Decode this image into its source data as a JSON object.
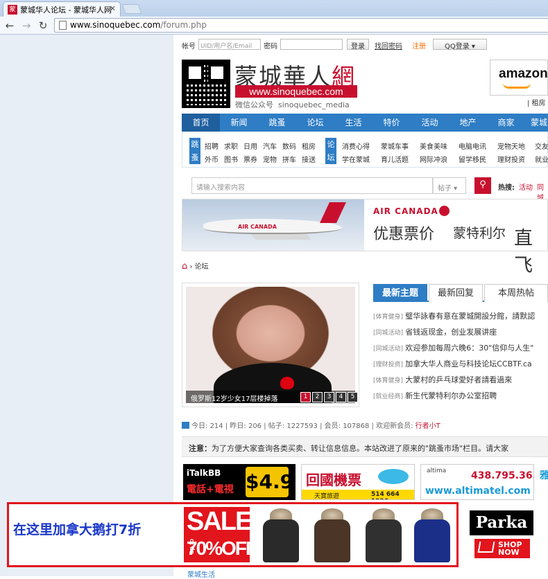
{
  "browser": {
    "tab_title": "蒙城华人论坛 - 蒙城华人网",
    "tab_favicon": "蒙",
    "url_domain": "www.sinoquebec.com",
    "url_path": "/forum.php"
  },
  "login": {
    "account_label": "帐号",
    "account_placeholder": "UID/用户名/Email",
    "password_label": "密码",
    "login_btn": "登录",
    "forgot": "找回密码",
    "register": "注册",
    "qq_login": "QQ登录"
  },
  "header": {
    "logo_text_a": "蒙城華人",
    "logo_text_b": "網",
    "logo_url": "www.sinoquebec.com",
    "wechat_label": "微信公众号",
    "wechat_id": "sinoquebec_media",
    "amazon_label": "amazon",
    "zufang": "| 租房"
  },
  "nav": {
    "items": [
      "首页",
      "新闻",
      "跳蚤",
      "论坛",
      "生活",
      "特价",
      "活动",
      "地产",
      "商家",
      "蒙城"
    ]
  },
  "subnav": {
    "tag1": "跳蚤",
    "tag2": "论坛",
    "row1_a": [
      "招聘",
      "求职",
      "日用",
      "汽车",
      "数码",
      "租房"
    ],
    "row2_a": [
      "外币",
      "图书",
      "票券",
      "宠物",
      "拼车",
      "接送"
    ],
    "row1_b": [
      "消费心得",
      "蒙城车事",
      "美食美味",
      "电脑电讯",
      "宠物天地",
      "交友"
    ],
    "row2_b": [
      "学在蒙城",
      "育儿活题",
      "网际冲浪",
      "留学移民",
      "理财投资",
      "就业"
    ]
  },
  "search": {
    "placeholder": "请输入搜索内容",
    "select": "帖子",
    "hot_label": "热搜:",
    "hot_words": [
      "活动",
      "同城"
    ]
  },
  "banner": {
    "brand": "AIR CANADA",
    "plane_label": "AIR CANADA",
    "t1": "优惠票价",
    "t2": "蒙特利尔",
    "t3": "直飞"
  },
  "breadcrumb": {
    "home": "⌂",
    "sep": "›",
    "current": "论坛"
  },
  "slider": {
    "caption": "俄罗斯12岁少女17层楼掉落",
    "pages": [
      "1",
      "2",
      "3",
      "4",
      "5"
    ]
  },
  "topics": {
    "tabs": [
      "最新主题",
      "最新回复",
      "本周热帖"
    ],
    "rows": [
      {
        "cat": "[体育健身]",
        "title": "璧华詠春有意在蒙城開設分館，請默認"
      },
      {
        "cat": "[同城活动]",
        "title": "省钱返现金，创业发展讲座"
      },
      {
        "cat": "[同城活动]",
        "title": "欢迎参加每周六晚6：30\"信仰与人生\""
      },
      {
        "cat": "[理财投资]",
        "title": "加拿大华人商业与科技论坛CCBTF.ca"
      },
      {
        "cat": "[体育健身]",
        "title": "大蒙村的乒乓球愛好者請看過來"
      },
      {
        "cat": "[就业经商]",
        "title": "新生代蒙特利尔办公室招聘"
      }
    ]
  },
  "stats": {
    "today_label": "今日:",
    "today": "214",
    "yesterday_label": "昨日:",
    "yesterday": "206",
    "posts_label": "帖子:",
    "posts": "1227593",
    "members_label": "会员:",
    "members": "107868",
    "welcome_label": "欢迎新会员:",
    "new_member": "行者小T"
  },
  "notice": {
    "label": "注意：",
    "text": "为了方便大家查询各类买卖、转让信息信息。本站改进了原来的\"跳蚤市场\"栏目。请大家"
  },
  "ads": {
    "italk_a": "iTalkBB",
    "italk_b": "電話+電視",
    "italk_price": "$4.99",
    "flight_a": "回國機票",
    "flight_b": "天寶旅遊",
    "flight_phone": "514 664 1996",
    "altima_name": "altima",
    "altima_phone": "438.795.3639",
    "altima_url": "www.altimatel.com",
    "side": "雅"
  },
  "bottom_ad": {
    "text": "在这里加拿大鹅打7折",
    "sale": "SALE",
    "off": "70%OFF",
    "upto": "up to",
    "parka": "Parka",
    "shop": "SHOP NOW"
  },
  "footer": {
    "label": "蒙城生活"
  },
  "colors": {
    "brand_red": "#c8102e",
    "nav_blue": "#2e7dc5"
  }
}
